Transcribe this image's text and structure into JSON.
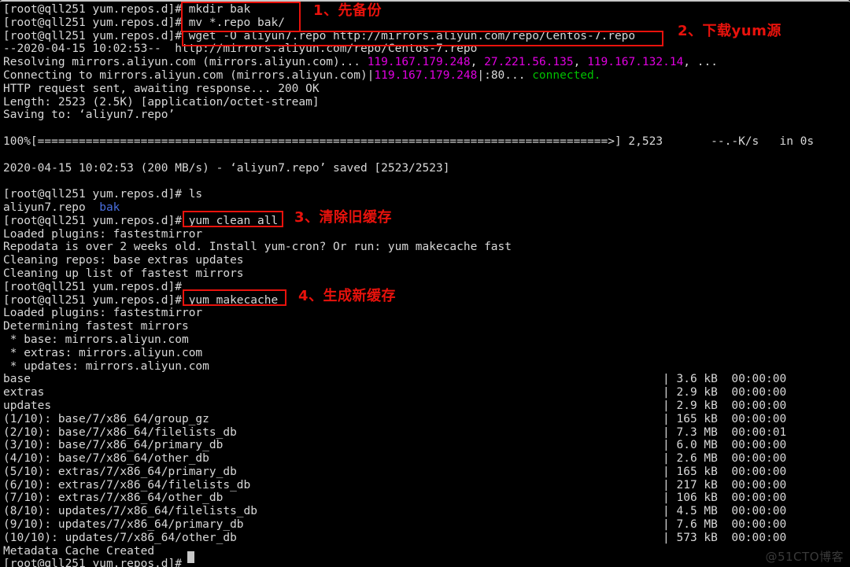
{
  "window": {
    "title_strip": "",
    "shell_prompt": "[root@qll251 yum.repos.d]#"
  },
  "watermark": "@51CTO博客",
  "annotations": [
    {
      "id": "step1",
      "label": "1、先备份",
      "color": "#e8120c"
    },
    {
      "id": "step2",
      "label": "2、下载yum源",
      "color": "#e8120c"
    },
    {
      "id": "step3",
      "label": "3、清除旧缓存",
      "color": "#e8120c"
    },
    {
      "id": "step4",
      "label": "4、生成新缓存",
      "color": "#e8120c"
    }
  ],
  "highlighted_commands": {
    "box1_line1": "mkdir bak",
    "box1_line2": "mv *.repo bak/",
    "box2": "wget -O aliyun7.repo http://mirrors.aliyun.com/repo/Centos-7.repo",
    "box3": "yum clean all",
    "box4": "yum makecache"
  },
  "terminal_lines": [
    {
      "segs": [
        {
          "t": "[root@qll251 yum.repos.d]# ",
          "c": "w"
        },
        {
          "t": "mkdir bak",
          "c": "w"
        }
      ]
    },
    {
      "segs": [
        {
          "t": "[root@qll251 yum.repos.d]# ",
          "c": "w"
        },
        {
          "t": "mv *.repo bak/",
          "c": "w"
        }
      ]
    },
    {
      "segs": [
        {
          "t": "[root@qll251 yum.repos.d]# ",
          "c": "w"
        },
        {
          "t": "wget -O aliyun7.repo http://mirrors.aliyun.com/repo/Centos-7.repo",
          "c": "w"
        }
      ]
    },
    {
      "segs": [
        {
          "t": "--2020-04-15 10:02:53--  http://mirrors.aliyun.com/repo/Centos-7.repo",
          "c": "w"
        }
      ]
    },
    {
      "segs": [
        {
          "t": "Resolving mirrors.aliyun.com (mirrors.aliyun.com)... ",
          "c": "w"
        },
        {
          "t": "119.167.179.248",
          "c": "mag"
        },
        {
          "t": ", ",
          "c": "w"
        },
        {
          "t": "27.221.56.135",
          "c": "mag"
        },
        {
          "t": ", ",
          "c": "w"
        },
        {
          "t": "119.167.132.14",
          "c": "mag"
        },
        {
          "t": ", ...",
          "c": "w"
        }
      ]
    },
    {
      "segs": [
        {
          "t": "Connecting to mirrors.aliyun.com (mirrors.aliyun.com)|",
          "c": "w"
        },
        {
          "t": "119.167.179.248",
          "c": "mag"
        },
        {
          "t": "|:80... ",
          "c": "w"
        },
        {
          "t": "connected.",
          "c": "grn"
        }
      ]
    },
    {
      "segs": [
        {
          "t": "HTTP request sent, awaiting response... 200 OK",
          "c": "w"
        }
      ]
    },
    {
      "segs": [
        {
          "t": "Length: 2523 (2.5K) [application/octet-stream]",
          "c": "w"
        }
      ]
    },
    {
      "segs": [
        {
          "t": "Saving to: ‘aliyun7.repo’",
          "c": "w"
        }
      ]
    },
    {
      "segs": [
        {
          "t": "",
          "c": "w"
        }
      ]
    },
    {
      "segs": [
        {
          "t": "100%[===================================================================================>] 2,523       --.-K/s   in 0s",
          "c": "w"
        }
      ]
    },
    {
      "segs": [
        {
          "t": "",
          "c": "w"
        }
      ]
    },
    {
      "segs": [
        {
          "t": "2020-04-15 10:02:53 (200 MB/s) - ‘aliyun7.repo’ saved [2523/2523]",
          "c": "w"
        }
      ]
    },
    {
      "segs": [
        {
          "t": "",
          "c": "w"
        }
      ]
    },
    {
      "segs": [
        {
          "t": "[root@qll251 yum.repos.d]# ls",
          "c": "w"
        }
      ]
    },
    {
      "segs": [
        {
          "t": "aliyun7.repo  ",
          "c": "w"
        },
        {
          "t": "bak",
          "c": "blu"
        }
      ]
    },
    {
      "segs": [
        {
          "t": "[root@qll251 yum.repos.d]# ",
          "c": "w"
        },
        {
          "t": "yum clean all",
          "c": "w"
        }
      ]
    },
    {
      "segs": [
        {
          "t": "Loaded plugins: fastestmirror",
          "c": "w"
        }
      ]
    },
    {
      "segs": [
        {
          "t": "Repodata is over 2 weeks old. Install yum-cron? Or run: yum makecache fast",
          "c": "w"
        }
      ]
    },
    {
      "segs": [
        {
          "t": "Cleaning repos: base extras updates",
          "c": "w"
        }
      ]
    },
    {
      "segs": [
        {
          "t": "Cleaning up list of fastest mirrors",
          "c": "w"
        }
      ]
    },
    {
      "segs": [
        {
          "t": "[root@qll251 yum.repos.d]#",
          "c": "w"
        }
      ]
    },
    {
      "segs": [
        {
          "t": "[root@qll251 yum.repos.d]# ",
          "c": "w"
        },
        {
          "t": "yum makecache",
          "c": "w"
        }
      ]
    },
    {
      "segs": [
        {
          "t": "Loaded plugins: fastestmirror",
          "c": "w"
        }
      ]
    },
    {
      "segs": [
        {
          "t": "Determining fastest mirrors",
          "c": "w"
        }
      ]
    },
    {
      "segs": [
        {
          "t": " * base: mirrors.aliyun.com",
          "c": "w"
        }
      ]
    },
    {
      "segs": [
        {
          "t": " * extras: mirrors.aliyun.com",
          "c": "w"
        }
      ]
    },
    {
      "segs": [
        {
          "t": " * updates: mirrors.aliyun.com",
          "c": "w"
        }
      ]
    },
    {
      "segs": [
        {
          "t": "base                                                                                            | 3.6 kB  00:00:00",
          "c": "w"
        }
      ]
    },
    {
      "segs": [
        {
          "t": "extras                                                                                          | 2.9 kB  00:00:00",
          "c": "w"
        }
      ]
    },
    {
      "segs": [
        {
          "t": "updates                                                                                         | 2.9 kB  00:00:00",
          "c": "w"
        }
      ]
    },
    {
      "segs": [
        {
          "t": "(1/10): base/7/x86_64/group_gz                                                                  | 165 kB  00:00:00",
          "c": "w"
        }
      ]
    },
    {
      "segs": [
        {
          "t": "(2/10): base/7/x86_64/filelists_db                                                              | 7.3 MB  00:00:01",
          "c": "w"
        }
      ]
    },
    {
      "segs": [
        {
          "t": "(3/10): base/7/x86_64/primary_db                                                                | 6.0 MB  00:00:00",
          "c": "w"
        }
      ]
    },
    {
      "segs": [
        {
          "t": "(4/10): base/7/x86_64/other_db                                                                  | 2.6 MB  00:00:00",
          "c": "w"
        }
      ]
    },
    {
      "segs": [
        {
          "t": "(5/10): extras/7/x86_64/primary_db                                                              | 165 kB  00:00:00",
          "c": "w"
        }
      ]
    },
    {
      "segs": [
        {
          "t": "(6/10): extras/7/x86_64/filelists_db                                                            | 217 kB  00:00:00",
          "c": "w"
        }
      ]
    },
    {
      "segs": [
        {
          "t": "(7/10): extras/7/x86_64/other_db                                                                | 106 kB  00:00:00",
          "c": "w"
        }
      ]
    },
    {
      "segs": [
        {
          "t": "(8/10): updates/7/x86_64/filelists_db                                                           | 4.5 MB  00:00:00",
          "c": "w"
        }
      ]
    },
    {
      "segs": [
        {
          "t": "(9/10): updates/7/x86_64/primary_db                                                             | 7.6 MB  00:00:00",
          "c": "w"
        }
      ]
    },
    {
      "segs": [
        {
          "t": "(10/10): updates/7/x86_64/other_db                                                              | 573 kB  00:00:00",
          "c": "w"
        }
      ]
    },
    {
      "segs": [
        {
          "t": "Metadata Cache Created",
          "c": "w"
        }
      ]
    },
    {
      "segs": [
        {
          "t": "[root@qll251 yum.repos.d]# ",
          "c": "w"
        }
      ]
    }
  ]
}
